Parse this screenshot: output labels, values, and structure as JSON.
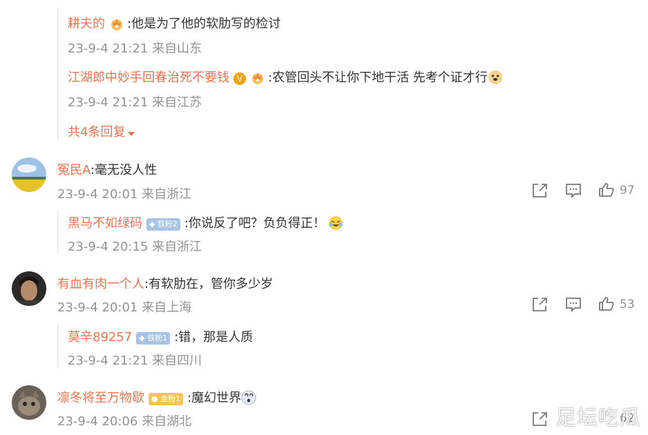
{
  "replies_top": [
    {
      "name": "耕夫的",
      "text": ":他是为了他的软肋写的检讨",
      "meta": "23-9-4 21:21 来自山东"
    },
    {
      "name": "江湖郎中妙手回春治死不要钱",
      "text": ":农管回头不让你下地干活 先考个证才行",
      "meta": "23-9-4 21:21 来自江苏"
    }
  ],
  "more_replies": "共4条回复",
  "comments": [
    {
      "name": "冤民A",
      "text": ":毫无没人性",
      "meta": "23-9-4 20:01 来自浙江",
      "likes": "97",
      "reply": {
        "name": "黑马不如绿码",
        "badge": "铁粉2",
        "text": ":你说反了吧？负负得正！",
        "meta": "23-9-4 20:15 来自浙江"
      }
    },
    {
      "name": "有血有肉一个人",
      "text": ":有软肋在，管你多少岁",
      "meta": "23-9-4 20:01 来自上海",
      "likes": "53",
      "reply": {
        "name": "莫辛89257",
        "badge": "铁粉1",
        "text": ":错，那是人质",
        "meta": "23-9-4 21:21 来自四川"
      }
    },
    {
      "name": "凛冬将至万物歇",
      "badge": "金粉1",
      "text": ":魔幻世界",
      "meta": "23-9-4 20:06 来自湖北",
      "likes": "62"
    }
  ],
  "watermark": "足坛吃瓜",
  "colors": {
    "name": "#eb7350",
    "meta": "#939393",
    "text": "#333333"
  }
}
